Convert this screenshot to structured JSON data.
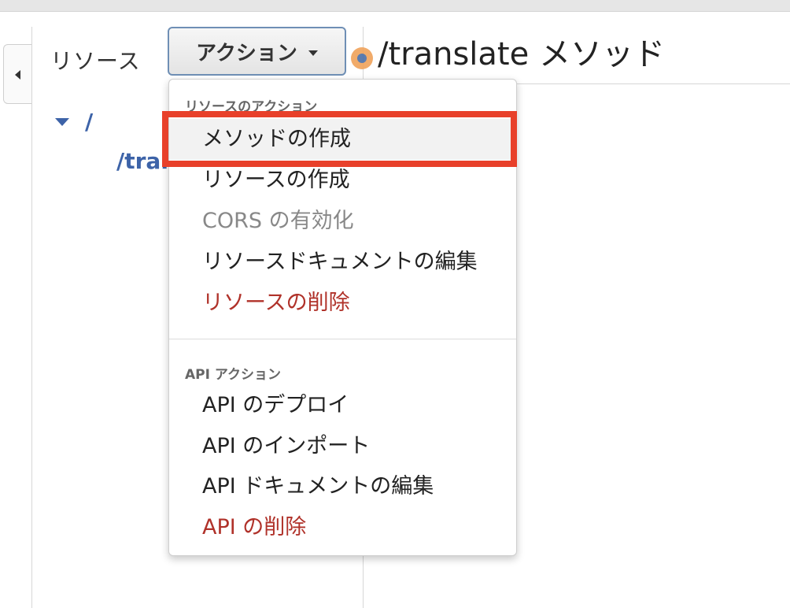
{
  "sidebar": {
    "resources_label": "リソース",
    "tree": {
      "root": "/",
      "child": "/tran"
    }
  },
  "toolbar": {
    "actions_label": "アクション"
  },
  "header": {
    "title": "/translate メソッド"
  },
  "menu": {
    "resource_section_header": "リソースのアクション",
    "resource_items": [
      "メソッドの作成",
      "リソースの作成",
      "CORS の有効化",
      "リソースドキュメントの編集",
      "リソースの削除"
    ],
    "api_section_header": "API アクション",
    "api_items": [
      "API のデプロイ",
      "API のインポート",
      "API ドキュメントの編集",
      "API の削除"
    ]
  },
  "colors": {
    "link_blue": "#3d63a8",
    "danger_red": "#b0322a",
    "highlight_red": "#e8402a",
    "indicator_orange": "#f0a35a"
  },
  "icons": {
    "collapse": "caret-left-icon",
    "dropdown": "caret-down-icon",
    "tree_expand": "triangle-down-icon"
  }
}
